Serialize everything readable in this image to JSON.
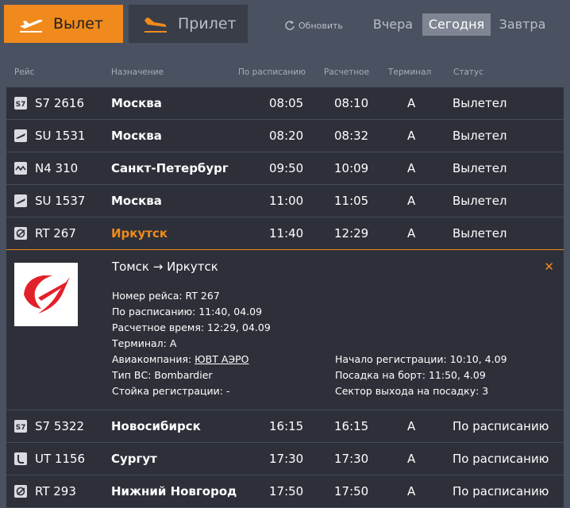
{
  "tabs": {
    "departure": {
      "label": "Вылет",
      "icon": "plane-takeoff-icon"
    },
    "arrival": {
      "label": "Прилет",
      "icon": "plane-landing-icon"
    }
  },
  "refresh_label": "Обновить",
  "days": [
    {
      "label": "Вчера",
      "active": false
    },
    {
      "label": "Сегодня",
      "active": true
    },
    {
      "label": "Завтра",
      "active": false
    }
  ],
  "columns": {
    "flight": "Рейс",
    "destination": "Назначение",
    "scheduled": "По расписанию",
    "estimated": "Расчетное",
    "terminal": "Терминал",
    "status": "Статус"
  },
  "colors": {
    "accent": "#f08a1c",
    "table_bg": "#2d3039",
    "page_bg": "#4a5261"
  },
  "flights": [
    {
      "icon": "s7-logo-icon",
      "flight": "S7 2616",
      "destination": "Москва",
      "scheduled": "08:05",
      "estimated": "08:10",
      "terminal": "A",
      "status": "Вылетел"
    },
    {
      "icon": "aeroflot-logo-icon",
      "flight": "SU 1531",
      "destination": "Москва",
      "scheduled": "08:20",
      "estimated": "08:32",
      "terminal": "A",
      "status": "Вылетел"
    },
    {
      "icon": "nordwind-logo-icon",
      "flight": "N4 310",
      "destination": "Санкт-Петербург",
      "scheduled": "09:50",
      "estimated": "10:09",
      "terminal": "A",
      "status": "Вылетел"
    },
    {
      "icon": "aeroflot-logo-icon",
      "flight": "SU 1537",
      "destination": "Москва",
      "scheduled": "11:00",
      "estimated": "11:05",
      "terminal": "A",
      "status": "Вылетел"
    },
    {
      "icon": "rt-logo-icon",
      "flight": "RT 267",
      "destination": "Иркутск",
      "scheduled": "11:40",
      "estimated": "12:29",
      "terminal": "A",
      "status": "Вылетел"
    }
  ],
  "detail": {
    "route": "Томск → Иркутск",
    "close_icon": "close-icon",
    "flight_number": "Номер рейса: RT 267",
    "scheduled": "По расписанию: 11:40, 04.09",
    "estimated": "Расчетное время: 12:29, 04.09",
    "terminal": "Терминал: A",
    "airline_label": "Авиакомпания: ",
    "airline_link": "ЮВТ АЭРО",
    "aircraft": "Тип ВС: Bombardier",
    "counter": "Стойка регистрации: -",
    "checkin_start": "Начало регистрации: 10:10, 4.09",
    "boarding": "Посадка на борт: 11:50, 4.09",
    "gate": "Сектор выхода на посадку: 3"
  },
  "flights_after": [
    {
      "icon": "s7-logo-icon",
      "flight": "S7 5322",
      "destination": "Новосибирск",
      "scheduled": "16:15",
      "estimated": "16:15",
      "terminal": "A",
      "status": "По расписанию"
    },
    {
      "icon": "utair-logo-icon",
      "flight": "UT 1156",
      "destination": "Сургут",
      "scheduled": "17:30",
      "estimated": "17:30",
      "terminal": "A",
      "status": "По расписанию"
    },
    {
      "icon": "rt-logo-icon",
      "flight": "RT 293",
      "destination": "Нижний Новгород",
      "scheduled": "17:50",
      "estimated": "17:50",
      "terminal": "A",
      "status": "По расписанию"
    }
  ]
}
